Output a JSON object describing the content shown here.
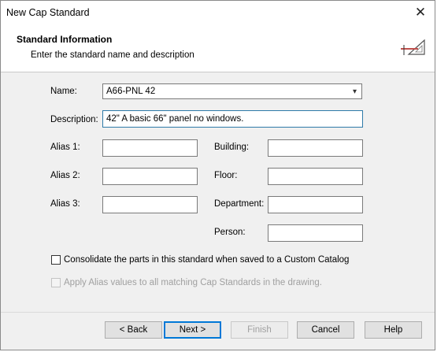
{
  "window": {
    "title": "New Cap Standard"
  },
  "header": {
    "title": "Standard Information",
    "subtitle": "Enter the standard name and description",
    "icon": "drafting-triangle-icon"
  },
  "form": {
    "name": {
      "label": "Name:",
      "value": "A66-PNL 42"
    },
    "description": {
      "label": "Description:",
      "value": "42\" A basic 66\" panel no windows."
    },
    "alias1": {
      "label": "Alias 1:",
      "value": ""
    },
    "alias2": {
      "label": "Alias 2:",
      "value": ""
    },
    "alias3": {
      "label": "Alias 3:",
      "value": ""
    },
    "building": {
      "label": "Building:",
      "value": ""
    },
    "floor": {
      "label": "Floor:",
      "value": ""
    },
    "department": {
      "label": "Department:",
      "value": ""
    },
    "person": {
      "label": "Person:",
      "value": ""
    }
  },
  "options": {
    "consolidate": {
      "label": "Consolidate the parts in this standard when saved to a Custom Catalog",
      "checked": false
    },
    "apply_alias": {
      "label": "Apply Alias values to all matching Cap Standards in the drawing.",
      "checked": false,
      "enabled": false
    }
  },
  "buttons": {
    "back": "< Back",
    "next": "Next >",
    "finish": "Finish",
    "cancel": "Cancel",
    "help": "Help"
  },
  "colors": {
    "focus_border": "#2e7aa8",
    "default_button_border": "#0078d7",
    "icon_accent": "#c0504d"
  }
}
